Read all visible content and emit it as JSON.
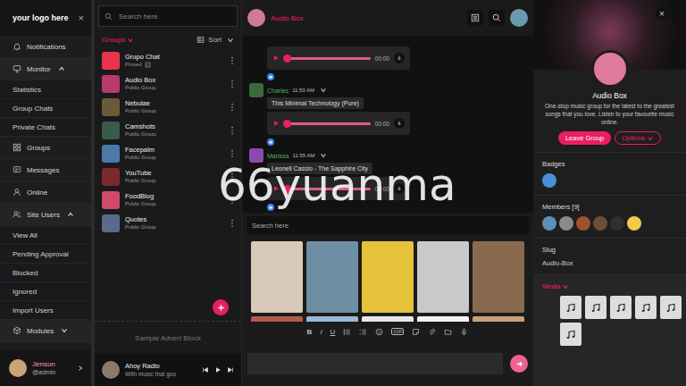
{
  "watermark": "66yuanma",
  "sidebar": {
    "logo": "your logo here",
    "close": "×",
    "items": [
      {
        "label": "Notifications",
        "kind": "item"
      },
      {
        "label": "Monitor",
        "kind": "section",
        "expanded": true
      },
      {
        "label": "Statistics",
        "kind": "sub"
      },
      {
        "label": "Group Chats",
        "kind": "sub"
      },
      {
        "label": "Private Chats",
        "kind": "sub"
      },
      {
        "label": "Groups",
        "kind": "item"
      },
      {
        "label": "Messages",
        "kind": "item"
      },
      {
        "label": "Online",
        "kind": "item"
      },
      {
        "label": "Site Users",
        "kind": "section",
        "expanded": true
      },
      {
        "label": "View All",
        "kind": "sub"
      },
      {
        "label": "Pending Approval",
        "kind": "sub"
      },
      {
        "label": "Blocked",
        "kind": "sub"
      },
      {
        "label": "Ignored",
        "kind": "sub"
      },
      {
        "label": "Import Users",
        "kind": "sub"
      },
      {
        "label": "Modules",
        "kind": "section",
        "expanded": false
      }
    ],
    "user": {
      "name": "Jenson",
      "handle": "@admin"
    }
  },
  "groups": {
    "search": "Search here",
    "title": "Groups",
    "sort": "Sort",
    "items": [
      {
        "name": "Grupo Chat",
        "subtitle": "Pinned",
        "pinned": true,
        "color": "#e8334a"
      },
      {
        "name": "Audio Box",
        "subtitle": "Public Group",
        "pinned": false,
        "color": "#b83a6a"
      },
      {
        "name": "Nebulae",
        "subtitle": "Public Group",
        "pinned": false,
        "color": "#6b5a3a"
      },
      {
        "name": "Camshots",
        "subtitle": "Public Group",
        "pinned": false,
        "color": "#3a5a4a"
      },
      {
        "name": "Facepalm",
        "subtitle": "Public Group",
        "pinned": false,
        "color": "#4a7aa8"
      },
      {
        "name": "YouTube",
        "subtitle": "Public Group",
        "pinned": false,
        "color": "#7a2a2a"
      },
      {
        "name": "FoodBlog",
        "subtitle": "Public Group",
        "pinned": false,
        "color": "#d04a6a"
      },
      {
        "name": "Quotes",
        "subtitle": "Public Group",
        "pinned": false,
        "color": "#5a6a8a"
      }
    ],
    "advert": "Sample Advert Block",
    "player": {
      "title": "Ahoy Radio",
      "subtitle": "With music that goo"
    }
  },
  "chat": {
    "title": "Audio Box",
    "messages": [
      {
        "kind": "audio",
        "time": "00:00",
        "level": 0
      },
      {
        "kind": "reaction"
      },
      {
        "kind": "header",
        "author": "Charles",
        "time": "11:53 AM",
        "color": "#3a6a3a"
      },
      {
        "kind": "text",
        "text": "This Minimal Technology (Pure)"
      },
      {
        "kind": "audio",
        "time": "00:00",
        "level": 0
      },
      {
        "kind": "reaction"
      },
      {
        "kind": "header",
        "author": "Marissa",
        "time": "11:55 AM",
        "color": "#8a4ab0"
      },
      {
        "kind": "text",
        "text": "Leonell Cassio - The Sapphire City"
      },
      {
        "kind": "audio",
        "time": "00:00",
        "level": 0
      },
      {
        "kind": "reaction"
      }
    ],
    "gif_search": "Search here",
    "gifs": [
      "#d9c9b8",
      "#6e8fa3",
      "#e6c23a",
      "#c9c9c9",
      "#8a6a4f",
      "#b35b4a",
      "#9ab8d6",
      "#e8e8e8",
      "#f4f4f4",
      "#c8a27a"
    ],
    "toolbar": {
      "format": [
        "B",
        "I",
        "U"
      ],
      "gif": "GIF"
    }
  },
  "info": {
    "close": "×",
    "title": "Audio Box",
    "description": "One-stop music group for the latest to the greatest songs that you love. Listen to your favourite music online.",
    "leave": "Leave Group",
    "options": "Options",
    "badges_title": "Badges",
    "badges": [
      {
        "color": "#4a90d9"
      }
    ],
    "members_title": "Members [9]",
    "members": [
      {
        "color": "#5b8fb9"
      },
      {
        "color": "#8a8a8a"
      },
      {
        "color": "#a0522d"
      },
      {
        "color": "#6b4f3a"
      },
      {
        "color": "#2f2f2f"
      },
      {
        "color": "#f2c94c"
      }
    ],
    "slug_title": "Slug",
    "slug": "Audio-Box",
    "media_title": "Media",
    "media": [
      {
        "kind": "audio"
      },
      {
        "kind": "audio"
      },
      {
        "kind": "audio"
      },
      {
        "kind": "audio"
      },
      {
        "kind": "audio"
      },
      {
        "kind": "audio"
      }
    ]
  }
}
